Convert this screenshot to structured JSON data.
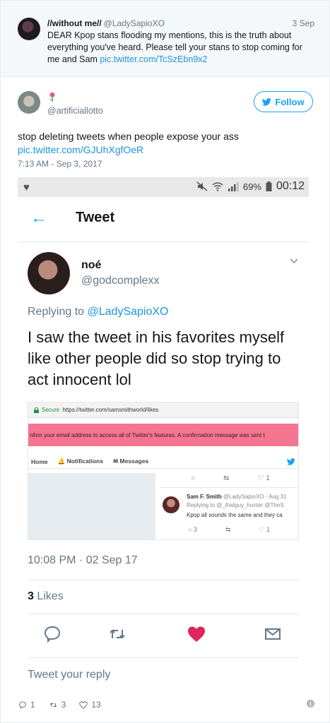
{
  "parent_tweet": {
    "name": "//without me//",
    "handle": "@LadySapioXO",
    "date": "3 Sep",
    "text": "DEAR Kpop stans flooding my mentions, this is the truth about everything you've heard. Please tell your stans to stop coming for me and Sam ",
    "link": "pic.twitter.com/TcSzEbn9x2"
  },
  "main_tweet": {
    "handle": "@artificiallotto",
    "follow_label": "Follow",
    "text": "stop deleting tweets when people expose your ass",
    "link": "pic.twitter.com/GJUhXgfOeR",
    "timestamp": "7:13 AM - Sep 3, 2017"
  },
  "phone": {
    "status_battery": "69%",
    "status_time": "00:12",
    "appbar_title": "Tweet",
    "tweet": {
      "name": "noé",
      "handle": "@godcomplexx",
      "replying_prefix": "Replying to ",
      "replying_handle": "@LadySapioXO",
      "text": "I saw the tweet in his favorites myself like other people did so stop trying to act innocent lol",
      "timestamp": "10:08 PM · 02 Sep 17",
      "likes_count": "3",
      "likes_label": " Likes",
      "reply_placeholder": "Tweet your reply"
    },
    "nested": {
      "secure": "Secure",
      "url": "https://twitter.com/samsmithworld/likes",
      "banner": "nfirm your email address to access all of Twitter's features. A confirmation message was sent t",
      "nav_home": "Home",
      "nav_notifications": "Notifications",
      "nav_messages": "Messages",
      "top_like_count": "1",
      "tweet_name": "Sam F. Smith",
      "tweet_meta": " @LadySapioXO · Aug 31",
      "tweet_reply": "Replying to @_thatguy_hunter @TheS",
      "tweet_text": "Kpop all sounds the same and they ca",
      "reply_count": "3",
      "like_count": "1"
    }
  },
  "bottom_actions": {
    "replies": "1",
    "retweets": "3",
    "likes": "13"
  },
  "colors": {
    "accent": "#1da1f2",
    "like_heart": "#e0245e",
    "banner": "#f4758f"
  }
}
